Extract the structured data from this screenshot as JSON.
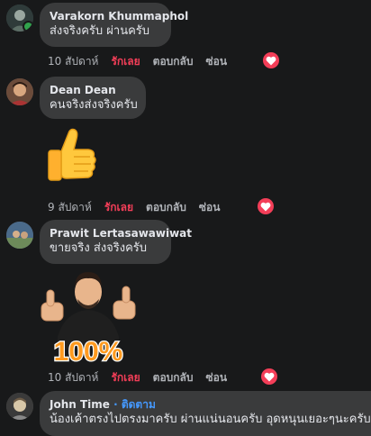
{
  "comments": [
    {
      "name": "Varakorn Khummaphol",
      "text": "ส่งจริงครับ ผ่านครับ",
      "time": "10 สัปดาห์",
      "like": "รักเลย",
      "reply": "ตอบกลับ",
      "hide": "ซ่อน",
      "reaction": "heart-icon"
    },
    {
      "name": "Dean Dean",
      "text": "คนจริงส่งจริงครับ",
      "time": "9 สัปดาห์",
      "like": "รักเลย",
      "reply": "ตอบกลับ",
      "hide": "ซ่อน",
      "reaction": "heart-icon",
      "sticker": "thumbs-up-emoji"
    },
    {
      "name": "Prawit Lertasawawiwat",
      "text": "ขายจริง ส่งจริงครับ",
      "time": "10 สัปดาห์",
      "like": "รักเลย",
      "reply": "ตอบกลับ",
      "hide": "ซ่อน",
      "reaction": "heart-icon",
      "sticker": "avatar-thumbs-up-100-percent",
      "sticker_text": "100%"
    },
    {
      "name": "John Time",
      "follow": "· ติดตาม",
      "text": "น้องเค้าตรงไปตรงมาครับ ผ่านแน่นอนครับ อุดหนุนเยอะๆนะครับ"
    }
  ],
  "colors": {
    "background": "#18191a",
    "bubble": "#3a3b3c",
    "like": "#f33e58",
    "follow": "#4599ff",
    "online": "#31a24c"
  }
}
